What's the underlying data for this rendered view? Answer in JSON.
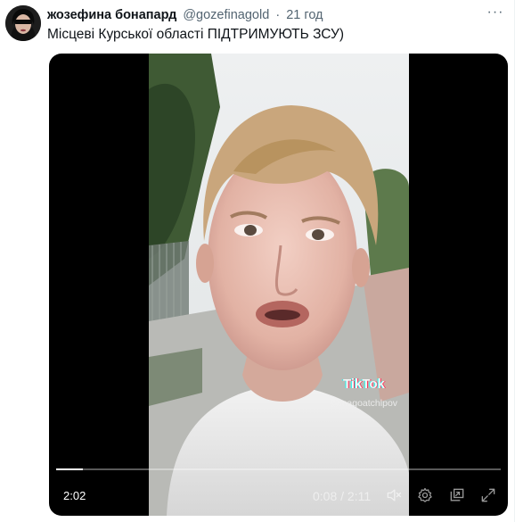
{
  "tweet": {
    "author_name": "жозефина бонапард",
    "handle": "@gozefinagold",
    "separator": "·",
    "time": "21 год",
    "more_label": "···",
    "text": "Місцеві Курської області ПІДТРИМУЮТЬ ЗСУ)"
  },
  "video": {
    "watermark_brand": "TikTok",
    "watermark_handle": "@magoatchlpov",
    "badge_duration": "2:02",
    "current_time": "0:08",
    "time_separator": " / ",
    "total_time": "2:11",
    "progress_fraction": 0.061
  },
  "icons": {
    "mute": "speaker-muted-icon",
    "settings": "gear-icon",
    "pip": "picture-in-picture-icon",
    "fullscreen": "fullscreen-icon",
    "more": "ellipsis-icon"
  },
  "colors": {
    "text_primary": "#0f1419",
    "text_secondary": "#536471",
    "video_background": "#000000"
  }
}
